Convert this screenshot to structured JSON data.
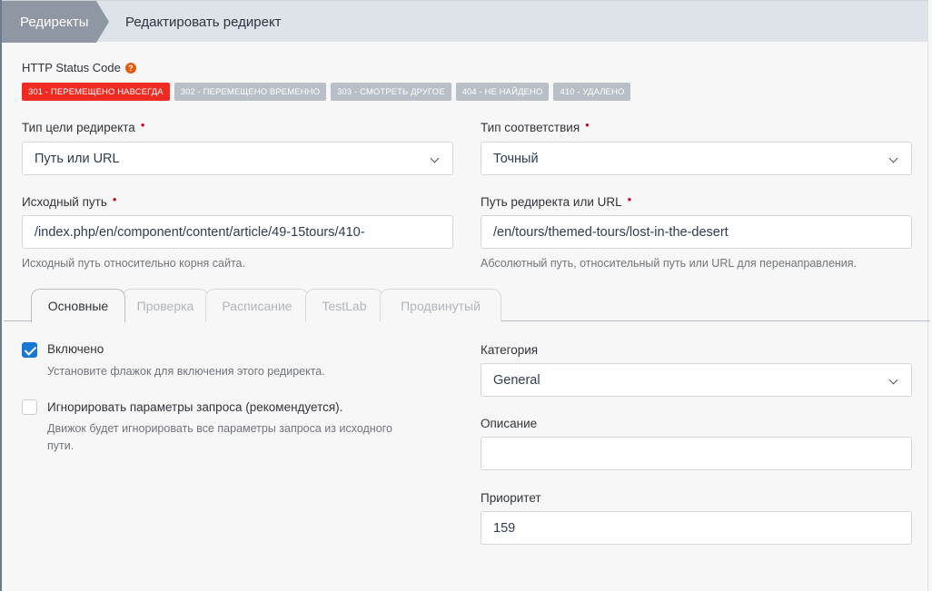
{
  "breadcrumb": {
    "root": "Редиректы",
    "current": "Редактировать редирект"
  },
  "status": {
    "label": "HTTP Status Code",
    "help_icon": "question-circle-icon",
    "codes": [
      {
        "label": "301 - ПЕРЕМЕЩЕНО НАВСЕГДА",
        "active": true
      },
      {
        "label": "302 - ПЕРЕМЕЩЕНО ВРЕМЕННО",
        "active": false
      },
      {
        "label": "303 - СМОТРЕТЬ ДРУГОЕ",
        "active": false
      },
      {
        "label": "404 - НЕ НАЙДЕНО",
        "active": false
      },
      {
        "label": "410 - УДАЛЕНО",
        "active": false
      }
    ]
  },
  "form": {
    "target_type": {
      "label": "Тип цели редиректа",
      "value": "Путь или URL"
    },
    "match_type": {
      "label": "Тип соответствия",
      "value": "Точный"
    },
    "source": {
      "label": "Исходный путь",
      "value": "/index.php/en/component/content/article/49-15tours/410-",
      "hint": "Исходный путь относительно корня сайта."
    },
    "target": {
      "label": "Путь редиректа или URL",
      "value": "/en/tours/themed-tours/lost-in-the-desert",
      "hint": "Абсолютный путь, относительный путь или URL для перенаправления."
    },
    "required_mark": "•"
  },
  "tabs": [
    {
      "label": "Основные",
      "active": true
    },
    {
      "label": "Проверка",
      "active": false
    },
    {
      "label": "Расписание",
      "active": false
    },
    {
      "label": "TestLab",
      "active": false
    },
    {
      "label": "Продвинутый",
      "active": false
    }
  ],
  "basic": {
    "enabled": {
      "label": "Включено",
      "checked": true,
      "hint": "Установите флажок для включения этого редиректа."
    },
    "ignore_params": {
      "label": "Игнорировать параметры запроса (рекомендуется).",
      "checked": false,
      "hint_line1": "Движок будет игнорировать все параметры запроса из исходного",
      "hint_line2": "пути."
    },
    "category": {
      "label": "Категория",
      "value": "General"
    },
    "description": {
      "label": "Описание",
      "value": ""
    },
    "priority": {
      "label": "Приоритет",
      "value": "159"
    }
  },
  "colors": {
    "accent": "#1877d2",
    "active_status": "#ee2a22",
    "inactive_status": "#b9bfc6",
    "required": "#d0021b"
  }
}
